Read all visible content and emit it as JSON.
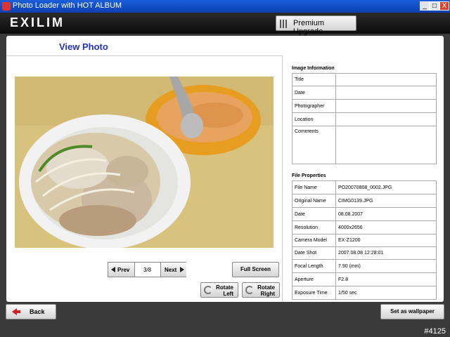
{
  "window": {
    "title": "Photo Loader with HOT ALBUM",
    "minimize": "_",
    "maximize": "□",
    "close": "X"
  },
  "header": {
    "logo": "EXILIM",
    "premium_label": "Premium Upgrade"
  },
  "page": {
    "title": "View Photo"
  },
  "nav": {
    "prev_label": "Prev",
    "next_label": "Next",
    "page_indicator": "3/8"
  },
  "buttons": {
    "full_screen": "Full Screen",
    "rotate_left_1": "Rotate",
    "rotate_left_2": "Left",
    "rotate_right_1": "Rotate",
    "rotate_right_2": "Right",
    "back": "Back",
    "wallpaper": "Set as wallpaper"
  },
  "image_info": {
    "title": "Image Information",
    "rows": [
      {
        "label": "Title",
        "value": ""
      },
      {
        "label": "Date",
        "value": ""
      },
      {
        "label": "Photographer",
        "value": ""
      },
      {
        "label": "Location",
        "value": ""
      },
      {
        "label": "Comments",
        "value": ""
      }
    ]
  },
  "file_props": {
    "title": "File Properties",
    "rows": [
      {
        "label": "File Name",
        "value": "PO20070808_0002.JPG"
      },
      {
        "label": "Original Name",
        "value": "CIMG0139.JPG"
      },
      {
        "label": "Date",
        "value": "08.08.2007"
      },
      {
        "label": "Resolution",
        "value": "4000x2656"
      },
      {
        "label": "Camera Model",
        "value": "EX-Z1200"
      },
      {
        "label": "Date Shot",
        "value": "2007.08.08 12:28:01"
      },
      {
        "label": "Focal Length",
        "value": "7.90 (mm)"
      },
      {
        "label": "Aperture",
        "value": "F2.8"
      },
      {
        "label": "Exposure Time",
        "value": "1/50 sec"
      }
    ]
  },
  "watermark": "#4125",
  "colors": {
    "title_blue": "#2633b4",
    "titlebar": "#0b3fb4"
  }
}
